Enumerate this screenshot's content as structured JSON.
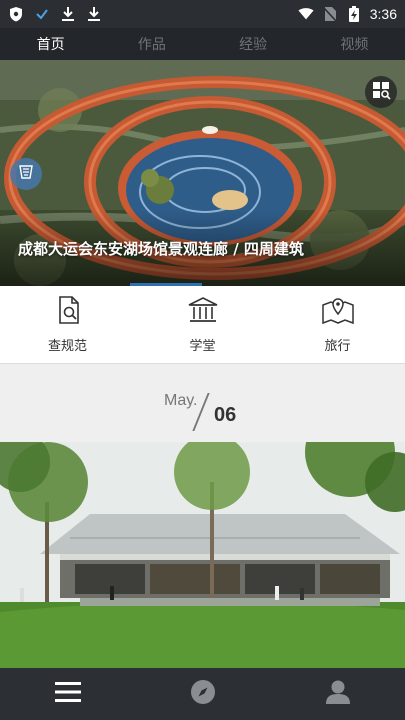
{
  "status_bar": {
    "time": "3:36",
    "icons": [
      "shield-icon",
      "check-icon",
      "download-icon",
      "download-icon",
      "wifi-icon",
      "no-sim-icon",
      "battery-charging-icon"
    ]
  },
  "tabs": [
    {
      "label": "首页",
      "active": true
    },
    {
      "label": "作品",
      "active": false
    },
    {
      "label": "经验",
      "active": false
    },
    {
      "label": "视频",
      "active": false
    }
  ],
  "hero": {
    "title": "成都大运会东安湖场馆景观连廊 / 四周建筑",
    "grid_button_icon": "grid-search-icon",
    "left_button_icon": "document-icon"
  },
  "quick_nav": [
    {
      "label": "查规范",
      "icon": "doc-search-icon"
    },
    {
      "label": "学堂",
      "icon": "building-icon"
    },
    {
      "label": "旅行",
      "icon": "map-pin-icon"
    }
  ],
  "date": {
    "month": "May.",
    "day": "06"
  },
  "bottom_nav": [
    {
      "icon": "menu-icon"
    },
    {
      "icon": "compass-icon"
    },
    {
      "icon": "user-icon"
    }
  ],
  "colors": {
    "status_bar": "#2b2e32",
    "tab_bar": "#23262a",
    "accent": "#2f6fae",
    "bottom_bar": "#2c2f33"
  }
}
